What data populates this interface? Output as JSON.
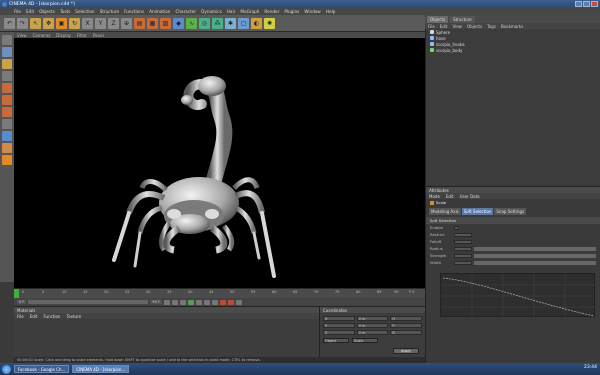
{
  "window": {
    "title": "CINEMA 4D - [skorpion.c4d *]"
  },
  "menu": [
    "File",
    "Edit",
    "Objects",
    "Tools",
    "Selection",
    "Structure",
    "Functions",
    "Animation",
    "Character",
    "Dynamics",
    "Hair",
    "MoGraph",
    "Render",
    "Plugins",
    "Window",
    "Help"
  ],
  "viewport": {
    "menu": [
      "View",
      "Cameras",
      "Display",
      "Filter",
      "Panel"
    ]
  },
  "timeline": {
    "ticks": [
      "0",
      "5",
      "10",
      "15",
      "20",
      "25",
      "30",
      "35",
      "40",
      "45",
      "50",
      "55",
      "60",
      "65",
      "70",
      "75",
      "80",
      "85",
      "90",
      "F 0"
    ],
    "frame_start": "0 F",
    "frame_end": "90 F"
  },
  "materials": {
    "title": "Materials",
    "menu": [
      "File",
      "Edit",
      "Function",
      "Texture"
    ]
  },
  "coordinates": {
    "title": "Coordinates",
    "apply_label": "Apply",
    "fields": [
      "X",
      "0 m",
      "H",
      "Y",
      "0 m",
      "P",
      "Z",
      "0 m",
      "B"
    ],
    "dropdowns": [
      "Object",
      "Scale"
    ]
  },
  "status": {
    "text": "00:00:00   Scale: Click and drag to scale elements. Hold down SHIFT to quantize scale / add to the selection in point mode, CTRL to remove."
  },
  "objects_panel": {
    "tabs": [
      "Objects",
      "Structure"
    ],
    "menu": [
      "File",
      "Edit",
      "View",
      "Objects",
      "Tags",
      "Bookmarks"
    ],
    "items": [
      {
        "name": "Sphere",
        "color": "#d8d8d8"
      },
      {
        "name": "hose",
        "color": "#88c0ff"
      },
      {
        "name": "scorpio_hvaka",
        "color": "#88c0ff"
      },
      {
        "name": "scorpio_body",
        "color": "#7fd07f"
      }
    ]
  },
  "attributes": {
    "title": "Attributes",
    "menu": [
      "Mode",
      "Edit",
      "User Data"
    ],
    "object_label": "Scale",
    "tabs": [
      "Modeling Axis",
      "Soft Selection",
      "Snap Settings"
    ],
    "section": "Soft Selection",
    "rows": [
      {
        "label": "Enable"
      },
      {
        "label": "Restrict"
      },
      {
        "label": "Falloff"
      },
      {
        "label": "Radius"
      },
      {
        "label": "Strength"
      },
      {
        "label": "Width"
      }
    ]
  },
  "taskbar": {
    "tasks": [
      "Facebook - Google Ch...",
      "CINEMA 4D - [skorpion..."
    ],
    "clock": "23:44"
  },
  "colors": {
    "accent_blue": "#5b79a8",
    "viewport_bg": "#000000"
  }
}
